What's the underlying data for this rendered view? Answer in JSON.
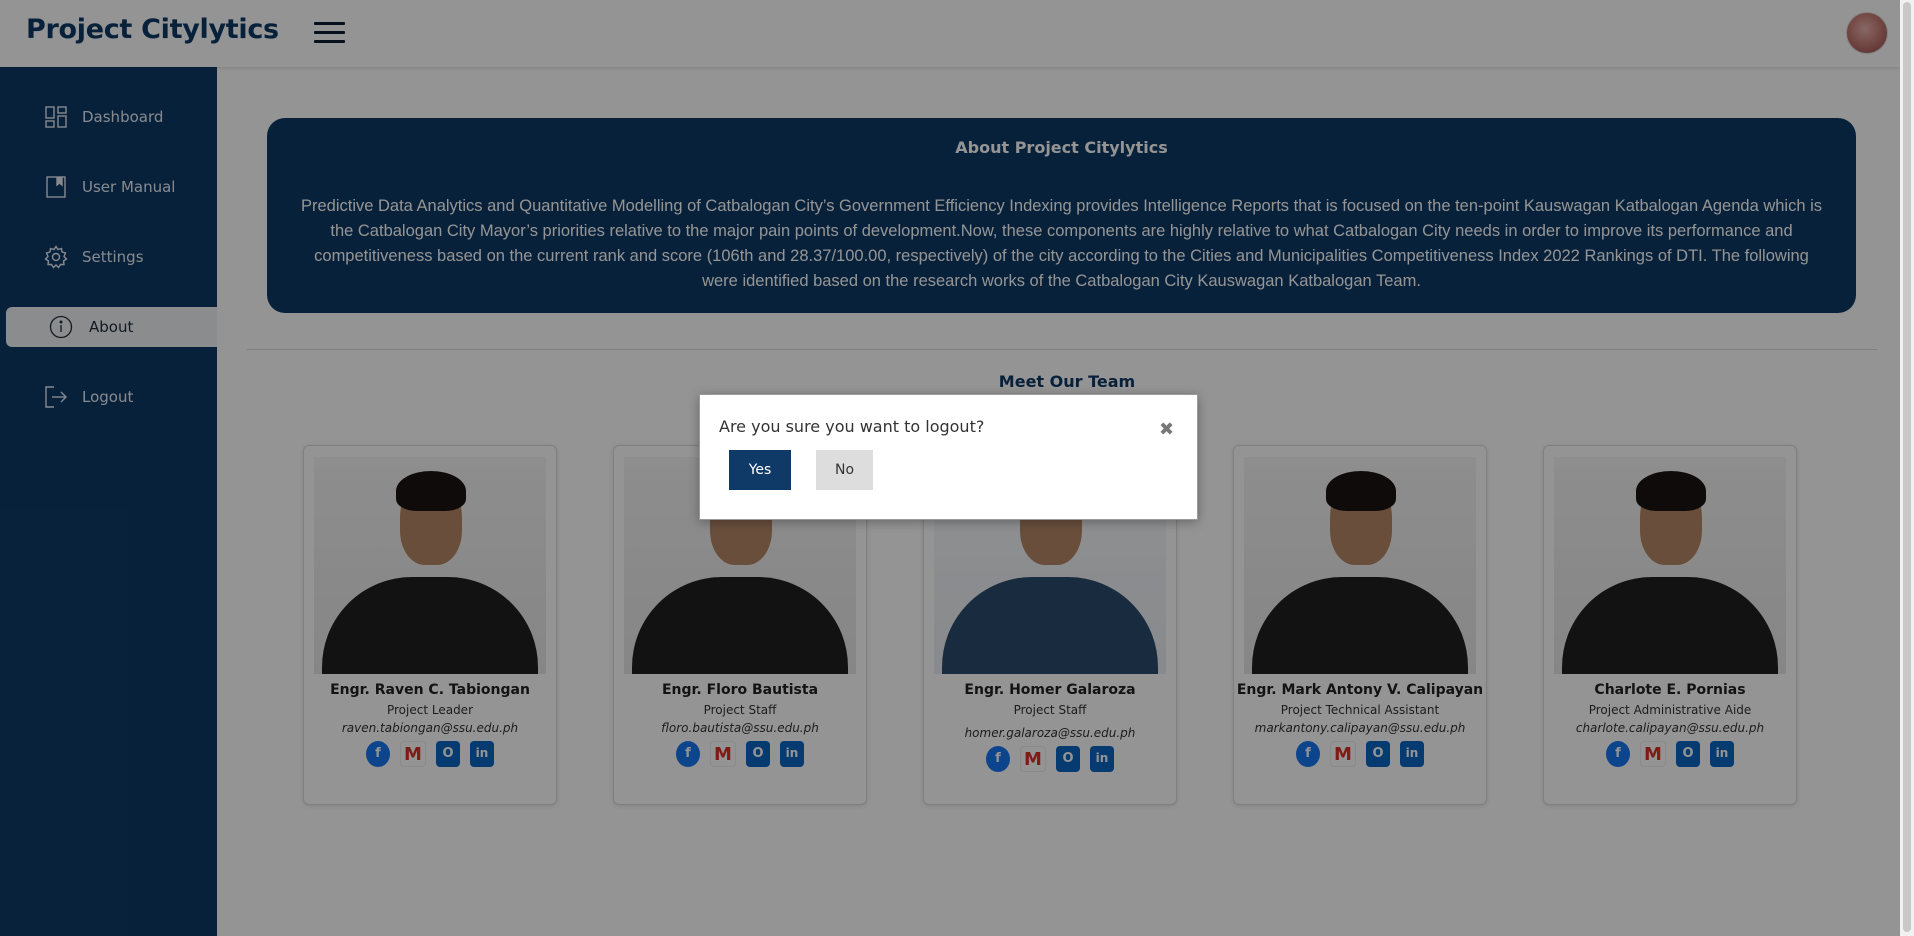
{
  "app": {
    "title": "Project Citylytics"
  },
  "sidebar": {
    "items": [
      {
        "label": "Dashboard",
        "icon": "dashboard-grid-icon"
      },
      {
        "label": "User Manual",
        "icon": "book-icon"
      },
      {
        "label": "Settings",
        "icon": "gear-icon"
      },
      {
        "label": "About",
        "icon": "info-icon",
        "active": true
      },
      {
        "label": "Logout",
        "icon": "logout-icon"
      }
    ]
  },
  "about": {
    "title": "About Project Citylytics",
    "text": "Predictive Data Analytics and Quantitative Modelling of Catbalogan City’s Government Efficiency Indexing provides Intelligence Reports that is focused on the ten-point Kauswagan Katbalogan Agenda which is the Catbalogan City Mayor’s priorities relative to the major pain points of development.Now, these components are highly relative to what Catbalogan City needs in order to improve its performance and competitiveness based on the current rank and score (106th and 28.37/100.00, respectively) of the city according to the Cities and Municipalities Competitiveness Index 2022 Rankings of DTI. The following were identified based on the research works of the Catbalogan City Kauswagan Katbalogan Team."
  },
  "team": {
    "title": "Meet Our Team",
    "members": [
      {
        "name": "Engr. Raven C. Tabiongan",
        "role": "Project Leader",
        "email": "raven.tabiongan@ssu.edu.ph"
      },
      {
        "name": "Engr. Floro Bautista",
        "role": "Project Staff",
        "email": "floro.bautista@ssu.edu.ph"
      },
      {
        "name": "Engr. Homer Galaroza",
        "role": "Project Staff",
        "email": "homer.galaroza@ssu.edu.ph"
      },
      {
        "name": "Engr. Mark Antony V. Calipayan",
        "role": "Project Technical Assistant",
        "email": "markantony.calipayan@ssu.edu.ph"
      },
      {
        "name": "Charlote E. Pornias",
        "role": "Project Administrative Aide",
        "email": "charlote.calipayan@ssu.edu.ph"
      }
    ],
    "social_icons": [
      "facebook-icon",
      "gmail-icon",
      "outlook-icon",
      "linkedin-icon"
    ]
  },
  "modal": {
    "message": "Are you sure you want to logout?",
    "close_glyph": "✖",
    "yes_label": "Yes",
    "no_label": "No"
  },
  "colors": {
    "primary": "#0f3a67",
    "overlay": "rgba(0,0,0,0.42)"
  }
}
